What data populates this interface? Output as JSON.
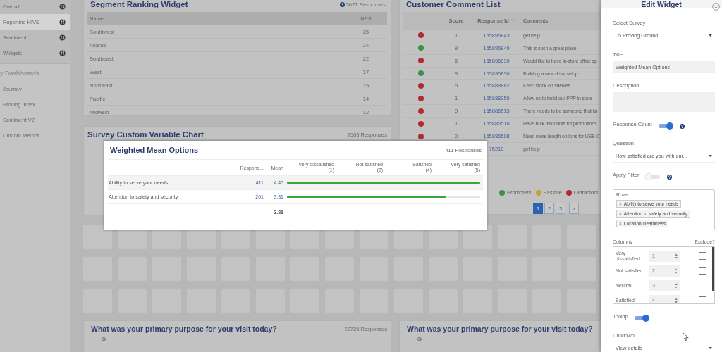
{
  "sidebar": {
    "items": [
      {
        "label": "Overall",
        "selected": false
      },
      {
        "label": "Reporting HIVE",
        "selected": true
      },
      {
        "label": "Sentiment",
        "selected": false
      },
      {
        "label": "Widgets",
        "selected": false
      }
    ],
    "section_title": "y Dashboards",
    "dashboards": [
      {
        "label": "Journey",
        "selected": false
      },
      {
        "label": "Proving Index",
        "selected": false
      },
      {
        "label": "Sentiment V2",
        "selected": false
      },
      {
        "label": "Custom Metrics",
        "selected": false
      }
    ]
  },
  "segment_ranking": {
    "title": "Segment Ranking Widget",
    "responses": "3671 Responses",
    "columns": [
      "Name",
      "NPS"
    ],
    "rows": [
      {
        "name": "Southwest",
        "nps": "25"
      },
      {
        "name": "Atlantic",
        "nps": "24"
      },
      {
        "name": "Southeast",
        "nps": "22"
      },
      {
        "name": "West",
        "nps": "17"
      },
      {
        "name": "Northeast",
        "nps": "15"
      },
      {
        "name": "Pacific",
        "nps": "14"
      },
      {
        "name": "Midwest",
        "nps": "12"
      }
    ]
  },
  "survey_chart": {
    "title": "Survey Custom Variable Chart",
    "responses": "7563 Responses"
  },
  "comment_list": {
    "title": "Customer Comment List",
    "columns": [
      "Score",
      "Response Id",
      "Comments"
    ],
    "rows": [
      {
        "color": "#b02a2e",
        "score": "1",
        "id": "165896843",
        "comment": "get help"
      },
      {
        "color": "#3f8f46",
        "score": "9",
        "id": "165896840",
        "comment": "This is such a great place."
      },
      {
        "color": "#b02a2e",
        "score": "6",
        "id": "165896839",
        "comment": "Would like to have in-store office sp"
      },
      {
        "color": "#3f8f46",
        "score": "9",
        "id": "165896830",
        "comment": "Building a new desk setup"
      },
      {
        "color": "#b02a2e",
        "score": "5",
        "id": "165888882",
        "comment": "Keep stock on shelves"
      },
      {
        "color": "#b02a2e",
        "score": "1",
        "id": "165888350",
        "comment": "Allow us to build our PPP in store"
      },
      {
        "color": "#b02a2e",
        "score": "0",
        "id": "165886513",
        "comment": "There needs to be someone that kn"
      },
      {
        "color": "#b02a2e",
        "score": "1",
        "id": "165886510",
        "comment": "Have bulk discounts for promotions"
      },
      {
        "color": "#b02a2e",
        "score": "0",
        "id": "165886508",
        "comment": "Need more length options for USB-C"
      },
      {
        "id": "75210",
        "comment": "get help"
      }
    ],
    "legend": [
      {
        "label": "Promoters",
        "color": "#3f8f46"
      },
      {
        "label": "Passive",
        "color": "#c9a22a"
      },
      {
        "label": "Detractors",
        "color": "#b02a2e"
      }
    ],
    "pages": [
      {
        "label": "1",
        "selected": true
      },
      {
        "label": "2",
        "selected": false
      },
      {
        "label": "3",
        "selected": false
      }
    ],
    "next": "›"
  },
  "bottom_widgets": [
    {
      "title": "What was your primary purpose for your visit today?",
      "responses": "22726 Responses",
      "axis_label": "6k"
    },
    {
      "title": "What was your primary purpose for your visit today?",
      "axis_label": "6k"
    }
  ],
  "weighted_mean": {
    "title": "Weighted Mean Options",
    "responses": "411 Responses",
    "columns": [
      "Respons...",
      "Mean"
    ],
    "scale": [
      {
        "label": "Very dissatisfied",
        "value": "(1)"
      },
      {
        "label": "Not satisfied",
        "value": "(2)"
      },
      {
        "label": "Satisfied",
        "value": "(4)"
      },
      {
        "label": "Very satisfied",
        "value": "(5)"
      }
    ],
    "rows": [
      {
        "label": "Ability to serve your needs",
        "responses": "411",
        "mean": "4.46",
        "level": 1.0
      },
      {
        "label": "Attention to safety and security",
        "responses": "201",
        "mean": "3.31",
        "level": 0.82
      }
    ],
    "total_mean": "3.88"
  },
  "edit_panel": {
    "title": "Edit Widget",
    "fields": [
      {
        "kind": "select",
        "label": "Select Survey",
        "value": "05 Proving Ground"
      },
      {
        "kind": "input",
        "label": "Title",
        "value": "Weighted Mean Options"
      },
      {
        "kind": "textarea",
        "label": "Description"
      },
      {
        "kind": "toggle",
        "label": "Response Count",
        "on": true,
        "help": true
      },
      {
        "kind": "select",
        "label": "Question",
        "value": "How satisfied are you with our..."
      },
      {
        "kind": "toggle",
        "label": "Apply Filter",
        "on": false,
        "help": true
      },
      {
        "kind": "tags",
        "label": "Rows",
        "tags": [
          {
            "label": "Ability to serve your needs",
            "remove": "×"
          },
          {
            "label": "Attention to safety and security",
            "remove": "×"
          },
          {
            "label": "Location cleanliness",
            "remove": "×"
          }
        ]
      },
      {
        "kind": "columns",
        "label": "Columns",
        "extra_label": "Exclude?",
        "items": [
          {
            "label": "Very dissatisfied",
            "value": "1",
            "checked": false
          },
          {
            "label": "Not satisfied",
            "value": "2",
            "checked": false
          },
          {
            "label": "Neutral",
            "value": "3",
            "checked": false
          },
          {
            "label": "Satisfied",
            "value": "4",
            "checked": false
          }
        ]
      },
      {
        "kind": "toggle",
        "label": "Tooltip",
        "on": true
      },
      {
        "kind": "select",
        "label": "Drilldown",
        "value": "View details"
      }
    ]
  }
}
